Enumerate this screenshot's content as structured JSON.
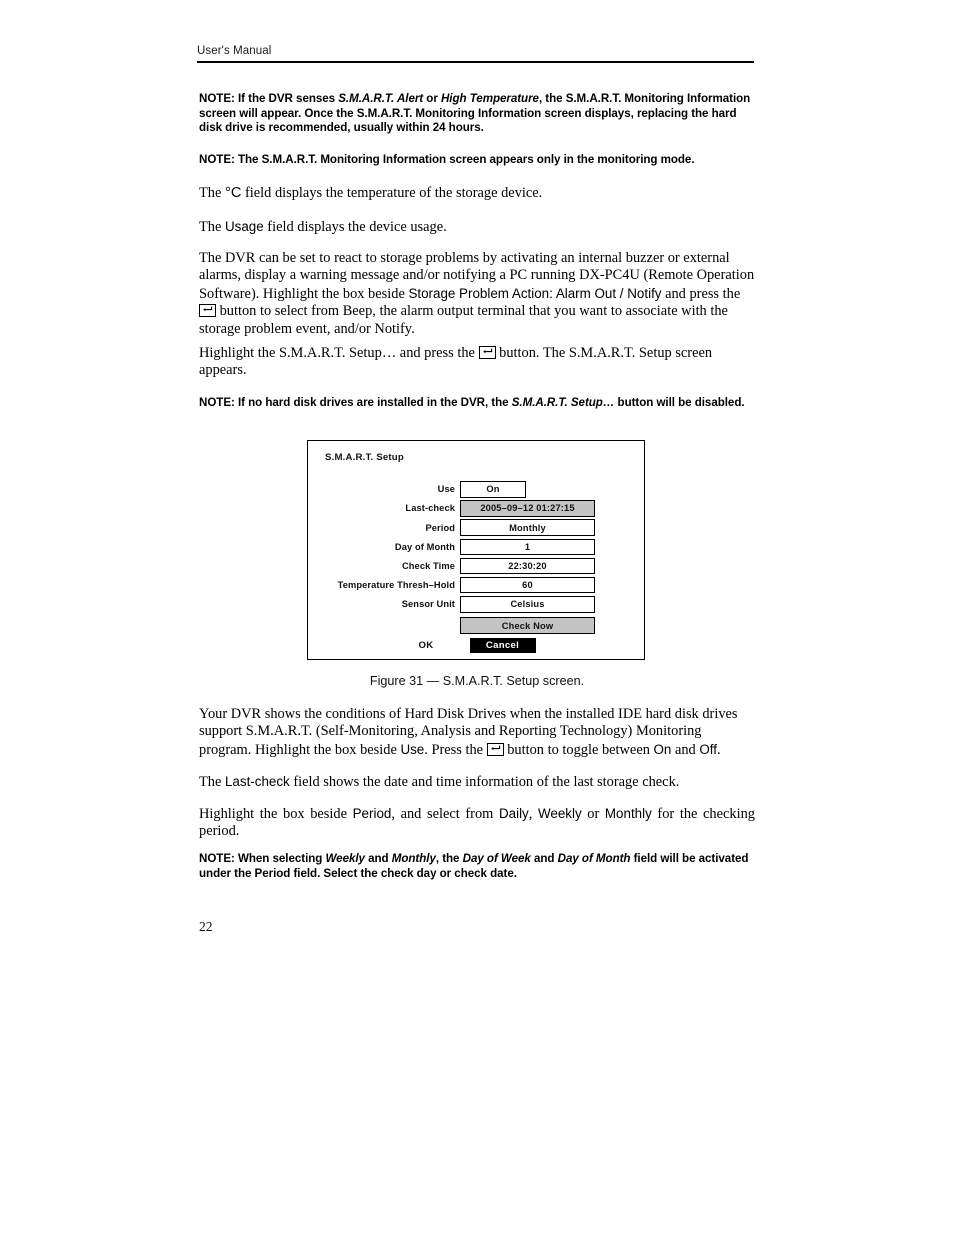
{
  "header": {
    "title": "User's Manual"
  },
  "notes": {
    "note1_pre": "NOTE:  If the DVR senses ",
    "note1_em1": "S.M.A.R.T. Alert",
    "note1_mid": " or ",
    "note1_em2": "High Temperature",
    "note1_post": ", the S.M.A.R.T. Monitoring Information screen will appear.  Once the S.M.A.R.T. Monitoring Information screen displays, replacing the hard disk drive is recommended, usually within 24 hours.",
    "note2": "NOTE:  The S.M.A.R.T. Monitoring Information screen appears only in the monitoring mode.",
    "note3_pre": "NOTE:  If no hard disk drives are installed in the DVR, the ",
    "note3_em": "S.M.A.R.T. Setup…",
    "note3_post": " button will be disabled.",
    "note4_pre": "NOTE:  When selecting ",
    "note4_em1": "Weekly",
    "note4_mid1": " and ",
    "note4_em2": "Monthly",
    "note4_mid2": ", the ",
    "note4_em3": "Day of Week",
    "note4_mid3": " and ",
    "note4_em4": "Day of Month",
    "note4_post": " field will be activated under the Period field.  Select the check day or check date."
  },
  "paragraphs": {
    "p_celsius_pre": "The ",
    "p_celsius_ui": "°C",
    "p_celsius_post": " field displays the temperature of the storage device.",
    "p_usage_pre": "The ",
    "p_usage_ui": "Usage",
    "p_usage_post": " field displays the device usage.",
    "p_dvr_react_1": "The DVR can be set to react to storage problems by activating an internal buzzer or external alarms, display a warning message and/or notifying a PC running DX-PC4U (Remote Operation Software). Highlight the box beside ",
    "p_dvr_react_ui": "Storage Problem Action: Alarm Out / Notify",
    "p_dvr_react_2": " and press the ",
    "p_dvr_react_3": " button to select from Beep, the alarm output terminal that you want to associate with the storage problem event, and/or Notify.",
    "p_highlight_1": "Highlight the S.M.A.R.T. Setup… and press the ",
    "p_highlight_2": " button.  The S.M.A.R.T. Setup screen appears.",
    "p_conditions_1": "Your DVR shows the conditions of Hard Disk Drives when the installed IDE hard disk drives support S.M.A.R.T. (Self-Monitoring, Analysis and Reporting Technology) Monitoring program. Highlight the box beside ",
    "p_conditions_ui_use": "Use",
    "p_conditions_2": ".  Press the ",
    "p_conditions_3": " button to toggle between ",
    "p_conditions_ui_on": "On",
    "p_conditions_4": " and ",
    "p_conditions_ui_off": "Off",
    "p_conditions_5": ".",
    "p_lastcheck_pre": "The ",
    "p_lastcheck_ui": "Last-check",
    "p_lastcheck_post": " field shows the date and time information of the last storage check.",
    "p_period_1": "Highlight the box beside ",
    "p_period_ui_period": "Period",
    "p_period_2": ", and select from ",
    "p_period_ui_daily": "Daily",
    "p_period_3": ", ",
    "p_period_ui_weekly": "Weekly",
    "p_period_4": " or ",
    "p_period_ui_monthly": "Monthly",
    "p_period_5": " for the checking period."
  },
  "dialog": {
    "title": "S.M.A.R.T. Setup",
    "fields": [
      {
        "label": "Use",
        "value": "On",
        "narrow": true,
        "shaded": false
      },
      {
        "label": "Last-check",
        "value": "2005–09–12  01:27:15",
        "narrow": false,
        "shaded": true
      },
      {
        "label": "Period",
        "value": "Monthly",
        "narrow": false,
        "shaded": false
      },
      {
        "label": "Day of Month",
        "value": "1",
        "narrow": false,
        "shaded": false
      },
      {
        "label": "Check Time",
        "value": "22:30:20",
        "narrow": false,
        "shaded": false
      },
      {
        "label": "Temperature Thresh–Hold",
        "value": "60",
        "narrow": false,
        "shaded": false
      },
      {
        "label": "Sensor Unit",
        "value": "Celsius",
        "narrow": false,
        "shaded": false
      }
    ],
    "check_now_label": "Check Now",
    "ok_label": "OK",
    "cancel_label": "Cancel"
  },
  "figure": {
    "caption": "Figure 31 — S.M.A.R.T. Setup screen."
  },
  "footer": {
    "page_number": "22"
  }
}
